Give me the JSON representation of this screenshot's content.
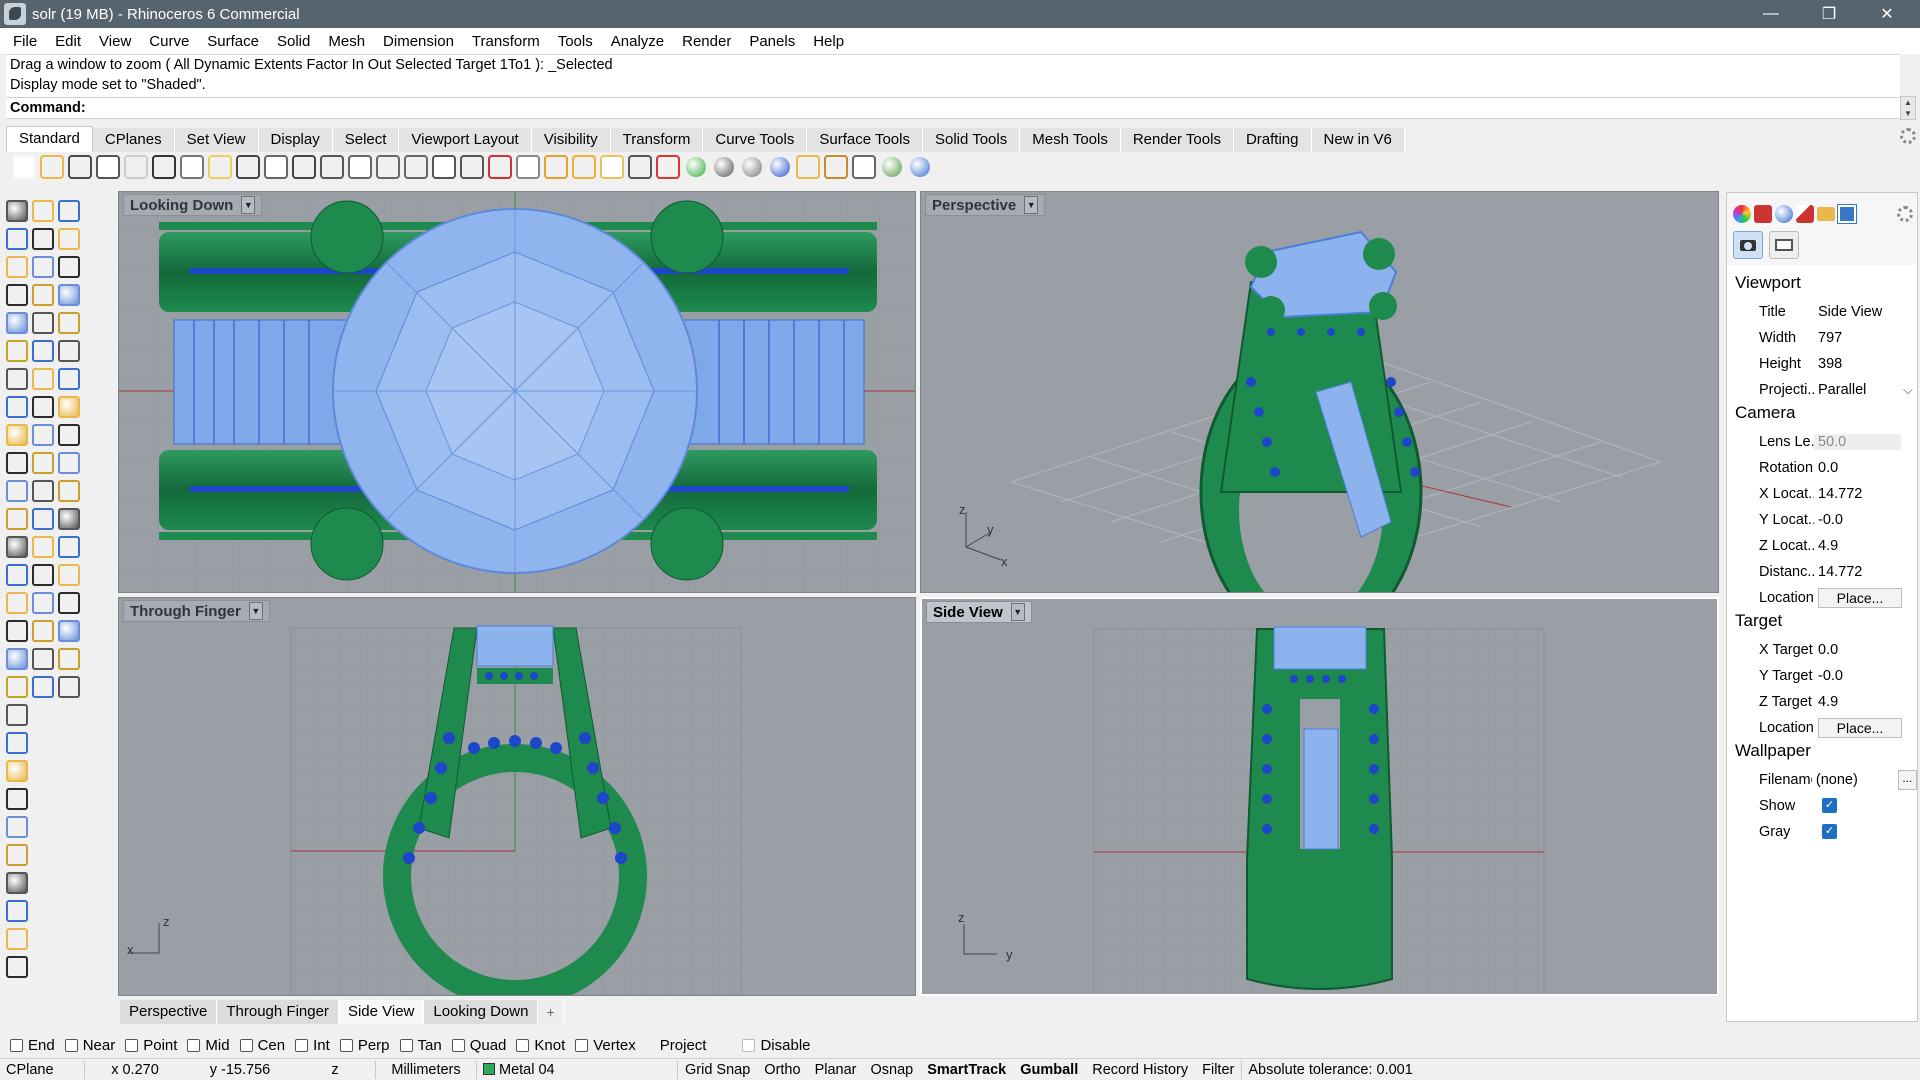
{
  "window": {
    "title": "solr (19 MB) - Rhinoceros 6 Commercial",
    "controls": [
      "—",
      "❐",
      "✕"
    ]
  },
  "menu": [
    "File",
    "Edit",
    "View",
    "Curve",
    "Surface",
    "Solid",
    "Mesh",
    "Dimension",
    "Transform",
    "Tools",
    "Analyze",
    "Render",
    "Panels",
    "Help"
  ],
  "history": [
    "Drag a window to zoom ( All  Dynamic  Extents  Factor  In  Out  Selected  Target  1To1 ): _Selected",
    "Display mode set to \"Shaded\"."
  ],
  "command": {
    "label": "Command:"
  },
  "toolbar_tabs": [
    "Standard",
    "CPlanes",
    "Set View",
    "Display",
    "Select",
    "Viewport Layout",
    "Visibility",
    "Transform",
    "Curve Tools",
    "Surface Tools",
    "Solid Tools",
    "Mesh Tools",
    "Render Tools",
    "Drafting",
    "New in V6"
  ],
  "toolbar_active_tab": "Standard",
  "standard_icons": [
    "new-icon",
    "open-icon",
    "save-icon",
    "print-icon",
    "import-icon",
    "cut-icon",
    "copy-icon",
    "paste-icon",
    "undo-icon",
    "pan-icon",
    "rotate-view-icon",
    "zoom-icon",
    "zoom-window-icon",
    "zoom-extents-icon",
    "zoom-selected-icon",
    "rotate-icon",
    "four-viewports-icon",
    "car-icon",
    "snapshot-icon",
    "named-cplane-icon",
    "named-view-icon",
    "lightbulb-icon",
    "lock-icon",
    "layer-icon",
    "color-wheel-icon",
    "sphere-render-icon",
    "shaded-sphere-icon",
    "material-sphere-icon",
    "paint-icon",
    "gears-icon",
    "bounding-box-icon",
    "globe-icon",
    "help-icon"
  ],
  "viewports": [
    {
      "name": "Looking Down",
      "active": false
    },
    {
      "name": "Perspective",
      "active": false
    },
    {
      "name": "Through Finger",
      "active": false
    },
    {
      "name": "Side View",
      "active": true
    }
  ],
  "axis_labels": {
    "perspective": {
      "z": "z",
      "y": "y",
      "x": "x"
    },
    "through_finger": {
      "z": "z",
      "x": "x"
    },
    "side_view": {
      "z": "z",
      "y": "y"
    }
  },
  "viewport_tabs": [
    "Perspective",
    "Through Finger",
    "Side View",
    "Looking Down"
  ],
  "viewport_tab_active": "Side View",
  "viewport_tab_add": "+",
  "panel": {
    "sections": {
      "viewport": "Viewport",
      "camera": "Camera",
      "target": "Target",
      "wallpaper": "Wallpaper"
    },
    "viewport_rows": [
      {
        "key": "Title",
        "value": "Side View"
      },
      {
        "key": "Width",
        "value": "797"
      },
      {
        "key": "Height",
        "value": "398"
      },
      {
        "key": "Projecti...",
        "value": "Parallel"
      }
    ],
    "camera_rows": [
      {
        "key": "Lens Le...",
        "value": "50.0",
        "disabled": true
      },
      {
        "key": "Rotation",
        "value": "0.0"
      },
      {
        "key": "X Locat...",
        "value": "14.772"
      },
      {
        "key": "Y Locat...",
        "value": "-0.0"
      },
      {
        "key": "Z Locat...",
        "value": "4.9"
      },
      {
        "key": "Distanc...",
        "value": "14.772"
      },
      {
        "key": "Location",
        "value": "Place..."
      }
    ],
    "target_rows": [
      {
        "key": "X Target",
        "value": "0.0"
      },
      {
        "key": "Y Target",
        "value": "-0.0"
      },
      {
        "key": "Z Target",
        "value": "4.9"
      },
      {
        "key": "Location",
        "value": "Place..."
      }
    ],
    "wallpaper_rows": [
      {
        "key": "Filename",
        "value": "(none)",
        "button": "..."
      },
      {
        "key": "Show",
        "checked": true
      },
      {
        "key": "Gray",
        "checked": true
      }
    ],
    "checkmark": "✓",
    "dropdown_glyph": "⌵"
  },
  "osnaps": [
    {
      "label": "End",
      "checked": false
    },
    {
      "label": "Near",
      "checked": false
    },
    {
      "label": "Point",
      "checked": false
    },
    {
      "label": "Mid",
      "checked": false
    },
    {
      "label": "Cen",
      "checked": false
    },
    {
      "label": "Int",
      "checked": false
    },
    {
      "label": "Perp",
      "checked": false
    },
    {
      "label": "Tan",
      "checked": false
    },
    {
      "label": "Quad",
      "checked": false
    },
    {
      "label": "Knot",
      "checked": false
    },
    {
      "label": "Vertex",
      "checked": false
    },
    {
      "label": "Project",
      "checked": false,
      "disabled": true
    },
    {
      "label": "Disable",
      "checked": false,
      "disabled": true
    }
  ],
  "status": {
    "cplane": "CPlane",
    "x": "x 0.270",
    "y": "y -15.756",
    "z": "z",
    "units": "Millimeters",
    "layer": "Metal 04",
    "toggles": [
      {
        "label": "Grid Snap",
        "bold": false
      },
      {
        "label": "Ortho",
        "bold": false
      },
      {
        "label": "Planar",
        "bold": false
      },
      {
        "label": "Osnap",
        "bold": false
      },
      {
        "label": "SmartTrack",
        "bold": true
      },
      {
        "label": "Gumball",
        "bold": true
      },
      {
        "label": "Record History",
        "bold": false
      },
      {
        "label": "Filter",
        "bold": false
      }
    ],
    "tolerance": "Absolute tolerance: 0.001"
  },
  "colors": {
    "titlebar": "#56646f",
    "viewport_bg": "#9a9fa6",
    "ring_green": "#1e8a4e",
    "gem_blue": "#8db3ee",
    "stone_blue": "#2a4fd0"
  }
}
